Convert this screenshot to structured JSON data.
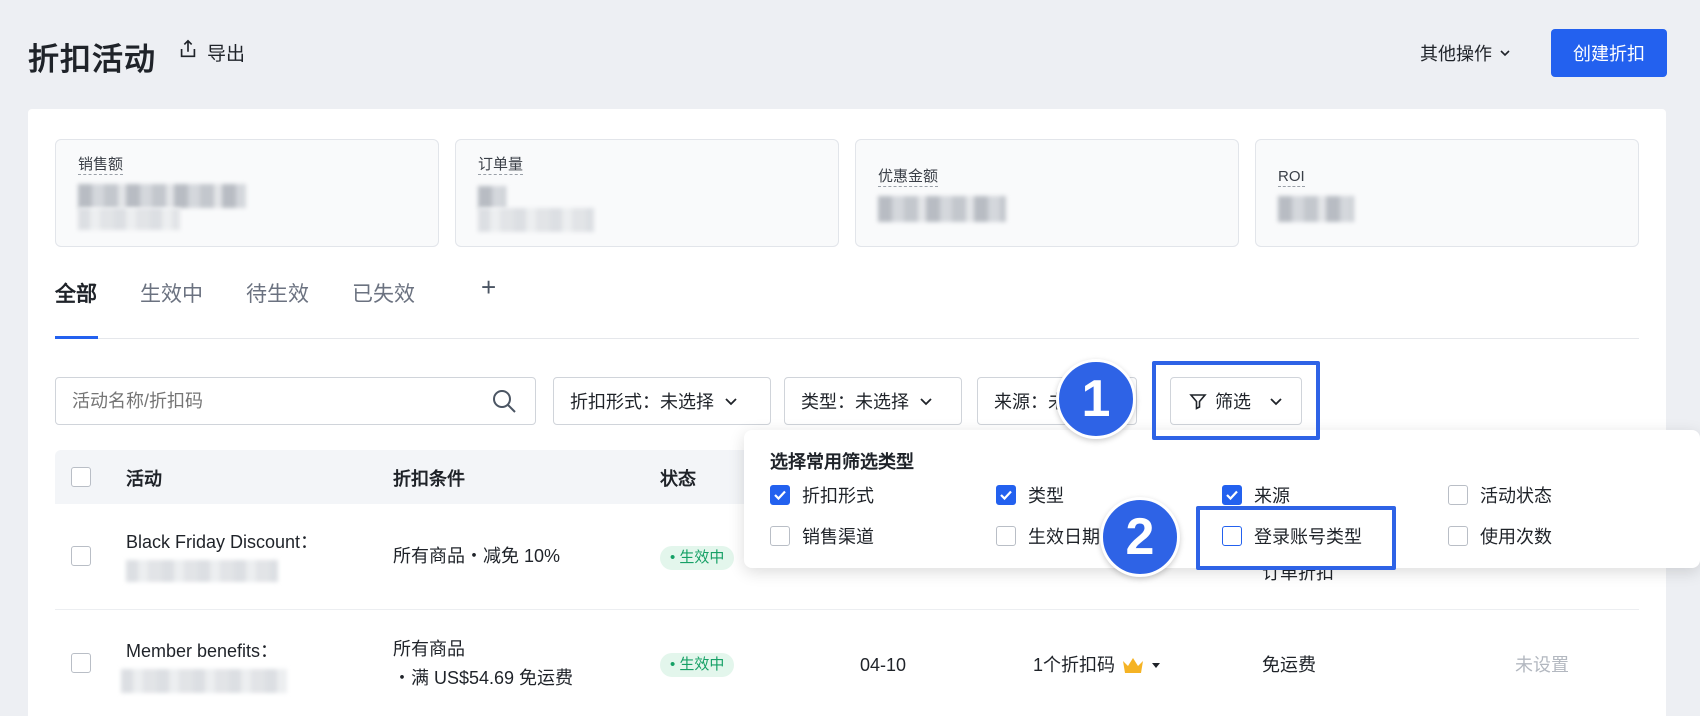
{
  "header": {
    "title": "折扣活动",
    "export_label": "导出",
    "other_ops_label": "其他操作",
    "create_label": "创建折扣"
  },
  "metrics": [
    {
      "label": "销售额"
    },
    {
      "label": "订单量"
    },
    {
      "label": "优惠金额"
    },
    {
      "label": "ROI"
    }
  ],
  "tabs": [
    "全部",
    "生效中",
    "待生效",
    "已失效"
  ],
  "add_tab_label": "+",
  "search": {
    "placeholder": "活动名称/折扣码"
  },
  "filters": {
    "discount_form": "折扣形式：未选择",
    "type": "类型：未选择",
    "source": "来源：未",
    "filter_button": "筛选"
  },
  "table": {
    "headers": [
      "活动",
      "折扣条件",
      "状态"
    ],
    "rows": [
      {
        "name": "Black Friday Discount：",
        "condition": "所有商品・减免 10%",
        "status": "生效中",
        "extra": "订单折扣"
      },
      {
        "name": "Member benefits：",
        "condition_line1": "所有商品",
        "condition_line2": "・满 US$54.69 免运费",
        "status": "生效中",
        "date": "04-10",
        "codes": "1个折扣码",
        "benefit": "免运费",
        "unset": "未设置"
      }
    ]
  },
  "dropdown": {
    "title": "选择常用筛选类型",
    "options": [
      {
        "label": "折扣形式",
        "checked": true
      },
      {
        "label": "类型",
        "checked": true
      },
      {
        "label": "来源",
        "checked": true
      },
      {
        "label": "活动状态",
        "checked": false
      },
      {
        "label": "销售渠道",
        "checked": false
      },
      {
        "label": "生效日期",
        "checked": false
      },
      {
        "label": "登录账号类型",
        "checked": false
      },
      {
        "label": "使用次数",
        "checked": false
      }
    ]
  },
  "annotations": {
    "badge1": "1",
    "badge2": "2"
  },
  "colors": {
    "primary": "#2361ef",
    "annotation": "#2e63e6",
    "status_green": "#16a066"
  }
}
